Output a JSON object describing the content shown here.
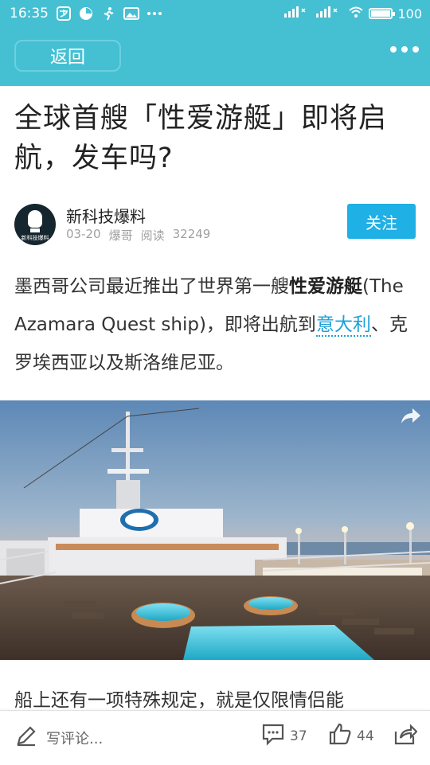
{
  "status_bar": {
    "time": "16:35",
    "battery": "100",
    "battery_level": 1.0
  },
  "nav": {
    "back_label": "返回"
  },
  "article": {
    "title": "全球首艘「性爱游艇」即将启航，发车吗?",
    "author": {
      "name": "新科技爆料",
      "avatar_text": "新科技爆料",
      "date": "03-20",
      "editor": "爆哥",
      "reads_label": "阅读",
      "reads": "32249"
    },
    "follow_label": "关注",
    "paragraph1": {
      "part1": "墨西哥公司最近推出了世界第一艘",
      "bold": "性爱游艇",
      "part2": "(The Azamara Quest ship)，即将出航到",
      "link": "意大利",
      "part3": "、克罗埃西亚以及斯洛维尼亚。"
    },
    "paragraph2": "船上还有一项特殊规定，就是仅限情侣能"
  },
  "bottom_bar": {
    "comment_placeholder": "写评论...",
    "comments_count": "37",
    "likes_count": "44"
  },
  "colors": {
    "header": "#45c0d3",
    "follow_button": "#1fb0e6",
    "link": "#1fa0d8"
  }
}
